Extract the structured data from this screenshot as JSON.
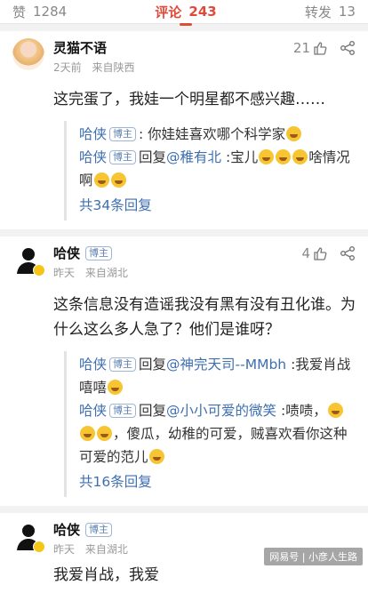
{
  "tabs": {
    "likes_label": "赞",
    "likes_count": "1284",
    "comments_label": "评论",
    "comments_count": "243",
    "shares_label": "转发",
    "shares_count": "13"
  },
  "comments": [
    {
      "user": "灵猫不语",
      "time": "2天前",
      "location": "来自陕西",
      "likes": "21",
      "content": "这完蛋了，我娃一个明星都不感兴趣……",
      "replies": [
        {
          "name": "哈侠",
          "tag": "博主",
          "prefix": ":",
          "text": " 你娃娃喜欢哪个科学家"
        },
        {
          "name": "哈侠",
          "tag": "博主",
          "prefix": "回复",
          "at": "@稚有北",
          "text": " :宝儿",
          "text2": "啥情况啊"
        }
      ],
      "more": "共34条回复"
    },
    {
      "user": "哈侠",
      "tag": "博主",
      "time": "昨天",
      "location": "来自湖北",
      "likes": "4",
      "content": "这条信息没有造谣我没有黑有没有丑化谁。为什么这么多人急了？他们是谁呀？",
      "replies": [
        {
          "name": "哈侠",
          "tag": "博主",
          "prefix": "回复",
          "at": "@神完天司--MMbh",
          "text": " :我爱肖战 嘻嘻"
        },
        {
          "name": "哈侠",
          "tag": "博主",
          "prefix": "回复",
          "at": "@小小可爱的微笑",
          "text": " :啧啧，",
          "text2": "，傻瓜，幼稚的可爱，贼喜欢看你这种可爱的范儿"
        }
      ],
      "more": "共16条回复"
    },
    {
      "user": "哈侠",
      "tag": "博主",
      "time": "昨天",
      "location": "来自湖北",
      "content": "我爱肖战，我爱"
    }
  ],
  "watermark": "网易号 | 小彦人生路"
}
